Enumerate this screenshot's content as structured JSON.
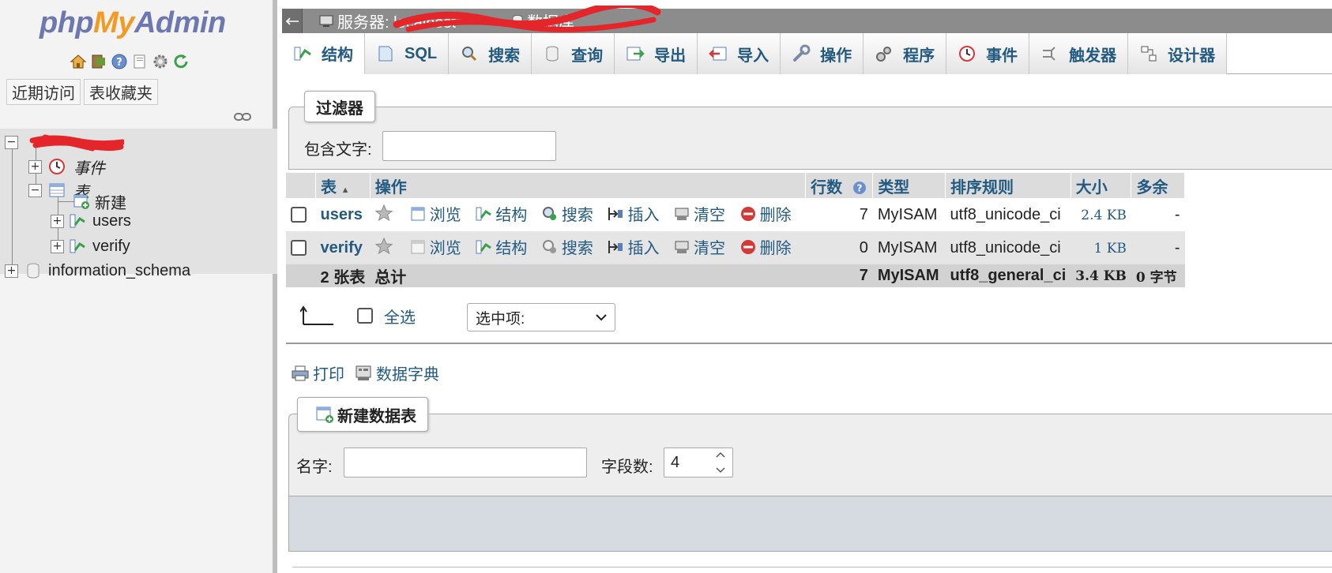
{
  "nav": {
    "logo": {
      "php": "php",
      "my": "My",
      "admin": "Admin"
    },
    "icons": [
      "home-icon",
      "logout-icon",
      "help-icon",
      "docs-icon",
      "settings-icon",
      "reload-icon"
    ],
    "tabs": [
      "近期访问",
      "表收藏夹"
    ],
    "tree": {
      "events_label": "事件",
      "tables_label": "表",
      "new_label": "新建",
      "tables": [
        "users",
        "verify"
      ],
      "other_db": "information_schema"
    }
  },
  "topbar": {
    "server_label": "服务器: localhost",
    "db_label": "数据库"
  },
  "tabs": [
    {
      "label": "结构",
      "icon": "structure-icon"
    },
    {
      "label": "SQL",
      "icon": "sql-icon"
    },
    {
      "label": "搜索",
      "icon": "search-icon"
    },
    {
      "label": "查询",
      "icon": "query-icon"
    },
    {
      "label": "导出",
      "icon": "export-icon"
    },
    {
      "label": "导入",
      "icon": "import-icon"
    },
    {
      "label": "操作",
      "icon": "wrench-icon"
    },
    {
      "label": "程序",
      "icon": "routines-icon"
    },
    {
      "label": "事件",
      "icon": "events-icon"
    },
    {
      "label": "触发器",
      "icon": "triggers-icon"
    },
    {
      "label": "设计器",
      "icon": "designer-icon"
    }
  ],
  "filter": {
    "legend": "过滤器",
    "label": "包含文字:",
    "value": ""
  },
  "table": {
    "headers": {
      "table": "表",
      "action": "操作",
      "rows": "行数",
      "type": "类型",
      "collation": "排序规则",
      "size": "大小",
      "overhead": "多余"
    },
    "actions": [
      "浏览",
      "结构",
      "搜索",
      "插入",
      "清空",
      "删除"
    ],
    "rows": [
      {
        "name": "users",
        "rows": "7",
        "type": "MyISAM",
        "collation": "utf8_unicode_ci",
        "size": "2.4 KB",
        "overhead": "-"
      },
      {
        "name": "verify",
        "rows": "0",
        "type": "MyISAM",
        "collation": "utf8_unicode_ci",
        "size": "1 KB",
        "overhead": "-"
      }
    ],
    "total": {
      "count": "2 张表",
      "label": "总计",
      "rows": "7",
      "type": "MyISAM",
      "collation": "utf8_general_ci",
      "size": "3.4 KB",
      "overhead": "0 字节"
    }
  },
  "bulk": {
    "select_all": "全选",
    "selected_option": "选中项:"
  },
  "links": {
    "print": "打印",
    "data_dict": "数据字典"
  },
  "create": {
    "legend": "新建数据表",
    "name_label": "名字:",
    "name_value": "",
    "fields_label": "字段数:",
    "fields_value": "4"
  },
  "colors": {
    "link": "#235a81",
    "nav_bg": "#f3f3f3",
    "topbar": "#8c8c8c",
    "header_bg": "#dcdcdc",
    "footer_bg": "#d6dbe1",
    "redaction": "#e4262b"
  }
}
